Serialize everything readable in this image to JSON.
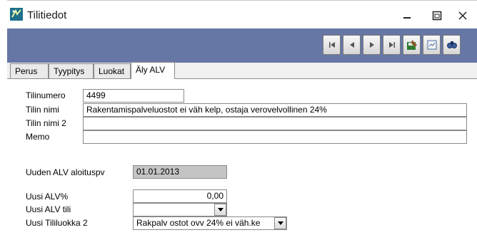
{
  "window": {
    "title": "Tilitiedot",
    "controls": {
      "minimize": "minimize",
      "maximize": "maximize",
      "close": "close"
    }
  },
  "toolbar": {
    "buttons": [
      "first-record-icon",
      "previous-record-icon",
      "next-record-icon",
      "last-record-icon",
      "save-icon",
      "print-icon",
      "find-icon"
    ]
  },
  "tabs": [
    {
      "label": "Perus",
      "active": false
    },
    {
      "label": "Tyypitys",
      "active": false
    },
    {
      "label": "Luokat",
      "active": false
    },
    {
      "label": "Äly ALV",
      "active": true
    }
  ],
  "form": {
    "tilinumero": {
      "label": "Tilinumero",
      "value": "4499"
    },
    "tilin_nimi": {
      "label": "Tilin nimi",
      "value": "Rakentamispalveluostot ei väh kelp, ostaja verovelvollinen 24%"
    },
    "tilin_nimi_2": {
      "label": "Tilin nimi 2",
      "value": ""
    },
    "memo": {
      "label": "Memo",
      "value": ""
    },
    "uuden_alv_aloituspv": {
      "label": "Uuden ALV aloituspv",
      "value": "01.01.2013"
    },
    "uusi_alv_pct": {
      "label": "Uusi ALV%",
      "value": "0,00"
    },
    "uusi_alv_tili": {
      "label": "Uusi ALV tili",
      "value": ""
    },
    "uusi_tililuokka_2": {
      "label": "Uusi Tililuokka 2",
      "value": "Rakpalv ostot ovv 24% ei väh.ke"
    }
  },
  "colors": {
    "band": "#6677a5",
    "readonly_field": "#c4c4c4"
  }
}
